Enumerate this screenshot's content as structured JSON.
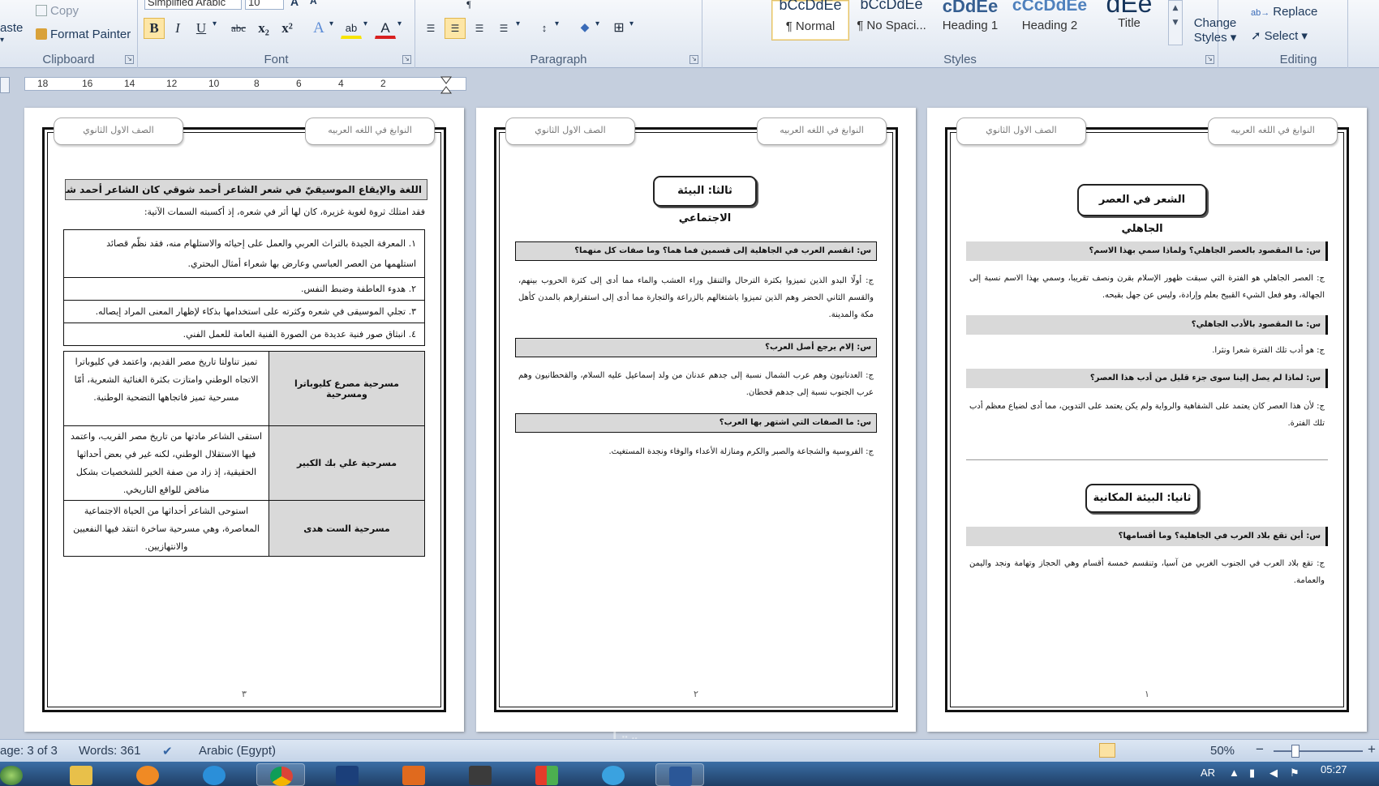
{
  "ribbon": {
    "clipboard": {
      "paste": "aste",
      "copy": "Copy",
      "format_painter": "Format Painter",
      "label": "Clipboard"
    },
    "font": {
      "font_name": "Simplified Arabic",
      "font_size": "10",
      "label": "Font",
      "bold": "B",
      "italic": "I",
      "underline": "U",
      "strike": "abc",
      "subscript": "x₂",
      "superscript": "x²",
      "font_color": "A",
      "highlight": "ab"
    },
    "paragraph": {
      "label": "Paragraph"
    },
    "styles": {
      "label": "Styles",
      "items": [
        {
          "preview": "bCcDdEe",
          "name": "¶ Normal"
        },
        {
          "preview": "bCcDdEe",
          "name": "¶ No Spaci..."
        },
        {
          "preview": "cDdEe",
          "name": "Heading 1"
        },
        {
          "preview": "cCcDdEe",
          "name": "Heading 2"
        },
        {
          "preview": "dEe",
          "name": "Title"
        }
      ],
      "change_styles": "Change Styles ▾"
    },
    "editing": {
      "label": "Editing",
      "replace": "Replace",
      "select": "Select ▾"
    }
  },
  "ruler": {
    "ticks": [
      "18",
      "16",
      "14",
      "12",
      "10",
      "8",
      "6",
      "4",
      "2"
    ]
  },
  "pages": [
    {
      "header_right": "النوابغ في اللغه العربيه",
      "header_left": "الصف الاول الثانوي",
      "page_number": "٣",
      "title": "اللغة والإيقاع الموسيقيّ في شعر الشاعر أحمد شوقي كان الشاعر أحمد شوقي متمكناً لغوياً.",
      "intro": "فقد امتلك ثروة لغوية غزيرة، كان لها أثر في شعره، إذ أكسبته السمات الآتية:",
      "list": [
        "١. المعرفة الجيدة بالتراث العربي والعمل على إحيائه والاستلهام منه، فقد نظّم قصائد استلهمها من العصر العباسي وعارض بها شعراء أمثال البحتري.",
        "٢. هدوء العاطفة وضبط النفس.",
        "٣. تجلي الموسيقى في شعره وكثرته على استخدامها بذكاء لإظهار المعنى المراد إيصاله.",
        "٤. انبثاق صور فنية عديدة من الصورة الفنية العامة للعمل الفني."
      ],
      "plays": [
        {
          "name": "مسرحية مصرع كليوباترا ومسرحية",
          "desc": "تميز تناولتا تاريخ مصر القديم، واعتمد في كليوباترا الاتجاه الوطني وامتازت بكثرة الغنائية الشعرية، أمّا مسرحية تميز فاتجاهها التضحية الوطنية."
        },
        {
          "name": "مسرحية علي بك الكبير",
          "desc": "استقى الشاعر مادتها من تاريخ مصر القريب، واعتمد فيها الاستقلال الوطني، لكنه غير في بعض أحداثها الحقيقية، إذ زاد من صفة الخير للشخصيات بشكل مناقض للواقع التاريخي."
        },
        {
          "name": "مسرحية الست هدى",
          "desc": "استوحى الشاعر أحداثها من الحياة الاجتماعية المعاصرة، وهي مسرحية ساخرة انتقد فيها النفعيين والانتهازيين."
        }
      ]
    },
    {
      "header_right": "النوابغ في اللغه العربيه",
      "header_left": "الصف الاول الثانوي",
      "page_number": "٢",
      "title": "ثالثا: البيئة الاجتماعي",
      "qa": [
        {
          "q": "س: انقسم العرب في الجاهلية إلى قسمين فما هما؟ وما صفات كل منهما؟",
          "a": "ج: أولًا البدو الذين تميزوا بكثرة الترحال والتنقل وراء العشب والماء مما أدى إلى كثرة الحروب بينهم، والقسم الثاني الحضر وهم الذين تميزوا باشتغالهم بالزراعة والتجارة مما أدى إلى استقرارهم بالمدن كأهل مكة والمدينة."
        },
        {
          "q": "س: إلام يرجع أصل العرب؟",
          "a": "ج: العدنانيون وهم عرب الشمال نسبة إلى جدهم عدنان من ولد إسماعيل عليه السلام، والقحطانيون وهم عرب الجنوب نسبة إلى جدهم قحطان."
        },
        {
          "q": "س: ما الصفات التي اشتهر بها العرب؟",
          "a": "ج: الفروسية والشجاعة والصبر والكرم ومنازلة الأعداء والوفاء ونجدة المستغيث."
        }
      ]
    },
    {
      "header_right": "النوابغ في اللغه العربيه",
      "header_left": "الصف الاول الثانوي",
      "page_number": "١",
      "title": "الشعر في العصر الجاهلي",
      "qa": [
        {
          "q": "س: ما المقصود بالعصر الجاهلي؟ ولماذا سمي بهذا الاسم؟",
          "a": "ج: العصر الجاهلي هو الفترة التي سبقت ظهور الإسلام بقرن ونصف تقريبا، وسمي بهذا الاسم نسبة إلى الجهالة، وهو فعل الشيء القبيح بعلم وإرادة، وليس عن جهل بقبحه."
        },
        {
          "q": "س: ما المقصود بالأدب الجاهلي؟",
          "a": "ج: هو أدب تلك الفترة شعرا ونثرا."
        },
        {
          "q": "س: لماذا لم يصل إلينا سوى جزء قليل من أدب هذا العصر؟",
          "a": "ج: لأن هذا العصر كان يعتمد على الشفاهية والرواية ولم يكن يعتمد على التدوين، مما أدى لضياع معظم أدب تلك الفترة."
        }
      ],
      "title2": "ثانيا: البيئة المكانية",
      "qa2": [
        {
          "q": "س: أين تقع بلاد العرب في الجاهلية؟ وما أقسامها؟",
          "a": "ج: تقع بلاد العرب في الجنوب الغربي من آسيا، وتنقسم خمسة أقسام وهي الحجاز وتهامة ونجد واليمن والعمامة."
        }
      ]
    }
  ],
  "statusbar": {
    "page": "age: 3 of 3",
    "words": "Words: 361",
    "language": "Arabic (Egypt)",
    "zoom": "50%",
    "zoom_minus": "−",
    "zoom_plus": "+"
  },
  "taskbar": {
    "lang": "AR",
    "time": "05:27"
  },
  "watermark": "مستقل"
}
